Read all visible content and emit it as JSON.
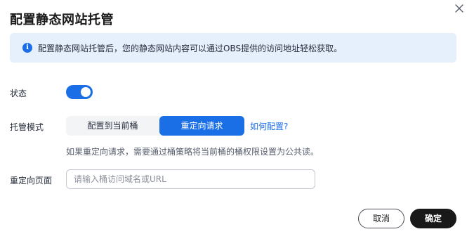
{
  "dialog": {
    "title": "配置静态网站托管",
    "close_icon": "close-icon"
  },
  "info": {
    "icon": "info-icon",
    "icon_glyph": "i",
    "text": "配置静态网站托管后，您的静态网站内容可以通过OBS提供的访问地址轻松获取。"
  },
  "status": {
    "label": "状态",
    "enabled": true
  },
  "hosting_mode": {
    "label": "托管模式",
    "options": [
      "配置到当前桶",
      "重定向请求"
    ],
    "selected": "重定向请求",
    "help_link": "如何配置?"
  },
  "hint": "如果重定向请求，需要通过桶策略将当前桶的桶权限设置为公共读。",
  "redirect_page": {
    "label": "重定向页面",
    "value": "",
    "placeholder": "请输入桶访问域名或URL"
  },
  "footer": {
    "cancel_label": "取消",
    "confirm_label": "确定"
  },
  "colors": {
    "accent": "#1a6ee6",
    "info_bg": "#e6f0fd",
    "primary_button": "#191919"
  }
}
